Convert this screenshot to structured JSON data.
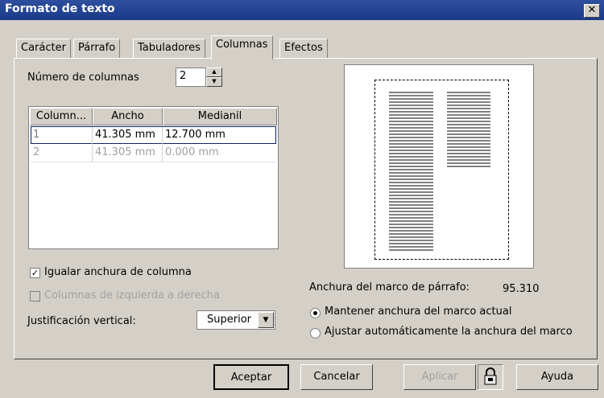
{
  "window": {
    "title": "Formato de texto",
    "close_label": "✕"
  },
  "tabs": [
    {
      "label": "Carácter"
    },
    {
      "label": "Párrafo"
    },
    {
      "label": "Tabuladores"
    },
    {
      "label": "Columnas",
      "active": true
    },
    {
      "label": "Efectos"
    }
  ],
  "columns": {
    "count_label": "Número de columnas",
    "count_value": "2",
    "table": {
      "headers": [
        "Column...",
        "Ancho",
        "Medianil"
      ],
      "rows": [
        {
          "col": "1",
          "ancho": "41.305 mm",
          "medianil": "12.700 mm",
          "selected": true
        },
        {
          "col": "2",
          "ancho": "41.305 mm",
          "medianil": "0.000 mm",
          "selected": false
        }
      ]
    },
    "equal_width_label": "Igualar anchura de columna",
    "equal_width_checked": true,
    "left_to_right_label": "Columnas de izquierda a derecha",
    "left_to_right_checked": false,
    "vjust_label": "Justificación vertical:",
    "vjust_value": "Superior",
    "frame_width_label": "Anchura del marco de párrafo:",
    "frame_width_value": "95.310",
    "radio_keep_label": "Mantener anchura del marco actual",
    "radio_auto_label": "Ajustar automáticamente la anchura del marco",
    "radio_selected": "keep"
  },
  "buttons": {
    "ok": "Aceptar",
    "cancel": "Cancelar",
    "apply": "Aplicar",
    "help": "Ayuda"
  },
  "colors": {
    "titlebar": "#1a3a8a",
    "face": "#d4d0c8",
    "selection_border": "#0a246a"
  }
}
